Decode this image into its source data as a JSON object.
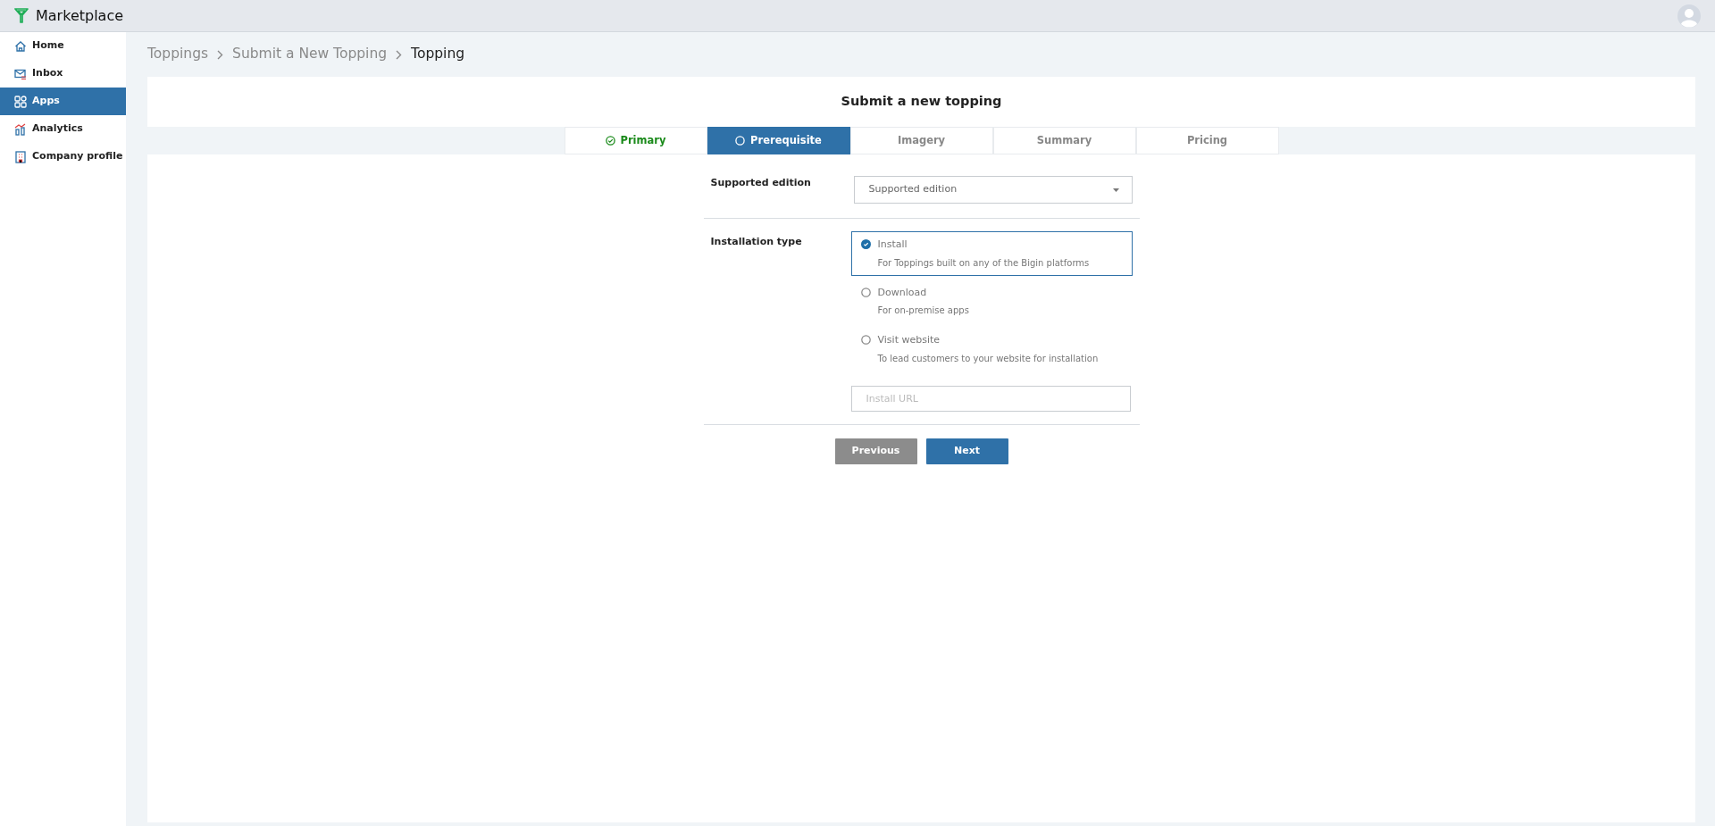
{
  "app": {
    "title": "Marketplace"
  },
  "sidebar": {
    "items": [
      {
        "label": "Home",
        "selected": false
      },
      {
        "label": "Inbox",
        "selected": false
      },
      {
        "label": "Apps",
        "selected": true
      },
      {
        "label": "Analytics",
        "selected": false
      },
      {
        "label": "Company profile",
        "selected": false
      }
    ]
  },
  "breadcrumb": [
    "Toppings",
    "Submit a New Topping",
    "Topping"
  ],
  "page_title": "Submit a new topping",
  "steps": [
    {
      "label": "Primary",
      "selected": false,
      "completed": true
    },
    {
      "label": "Prerequisite",
      "selected": true,
      "completed": false
    },
    {
      "label": "Imagery",
      "selected": false,
      "completed": false
    },
    {
      "label": "Summary",
      "selected": false,
      "completed": false
    },
    {
      "label": "Pricing",
      "selected": false,
      "completed": false
    }
  ],
  "form": {
    "supported_edition": {
      "label": "Supported edition",
      "placeholder": "Supported edition"
    },
    "installation_type": {
      "label": "Installation type",
      "options": [
        {
          "label": "Install",
          "description": "For Toppings built on any of the Bigin platforms",
          "selected": true
        },
        {
          "label": "Download",
          "description": "For on-premise apps",
          "selected": false
        },
        {
          "label": "Visit website",
          "description": "To lead customers to your website for installation",
          "selected": false
        }
      ]
    },
    "install_url": {
      "placeholder": "Install URL"
    }
  },
  "buttons": {
    "previous": "Previous",
    "next": "Next"
  }
}
